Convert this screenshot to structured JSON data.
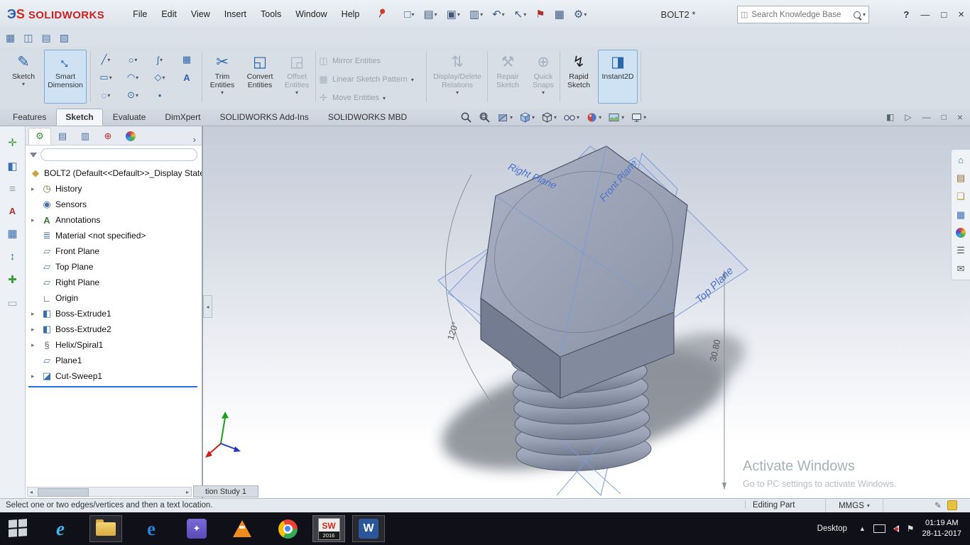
{
  "titlebar": {
    "logo_mark_d": "Э",
    "logo_mark_s": "S",
    "brand": "SOLIDWORKS",
    "menus": [
      "File",
      "Edit",
      "View",
      "Insert",
      "Tools",
      "Window",
      "Help"
    ],
    "document_title": "BOLT2 *",
    "search_placeholder": "Search Knowledge Base",
    "help": "?",
    "window": {
      "minimize": "—",
      "maximize": "□",
      "close": "×"
    }
  },
  "quickbar": {
    "glyphs": [
      "▦",
      "◫",
      "▤",
      "▧"
    ]
  },
  "toolbar": {
    "glyphs": [
      "□",
      "▤",
      "▣",
      "▥",
      "↶",
      "↖",
      "⚑",
      "▦",
      "⚙"
    ]
  },
  "ribbon": {
    "sketch": "Sketch",
    "smart_dimension": "Smart Dimension",
    "trim": "Trim Entities",
    "convert": "Convert Entities",
    "offset": "Offset Entities",
    "mirror": "Mirror Entities",
    "linear": "Linear Sketch Pattern",
    "move": "Move Entities",
    "display_delete": "Display/Delete Relations",
    "repair": "Repair Sketch",
    "quick_snaps": "Quick Snaps",
    "rapid": "Rapid Sketch",
    "instant2d": "Instant2D",
    "icons": {
      "sketch": "✎",
      "smart": "↔",
      "trim": "✂",
      "convert": "◱",
      "offset": "◲",
      "mirror": "◫",
      "linear": "▦",
      "move": "✛",
      "relations": "⇅",
      "repair": "⚒",
      "snaps": "⊕",
      "rapid": "↯",
      "instant": "◨"
    },
    "tools": [
      "╱",
      "○",
      "ʃ",
      "▦",
      "▭",
      "◠",
      "◇",
      "A",
      "◌",
      "⊙",
      "•"
    ]
  },
  "tabs": [
    "Features",
    "Sketch",
    "Evaluate",
    "DimXpert",
    "SOLIDWORKS Add-Ins",
    "SOLIDWORKS MBD"
  ],
  "doc_controls": [
    "◧",
    "▷",
    "—",
    "□",
    "×"
  ],
  "left_dock": [
    "✛",
    "◧",
    "≡",
    "A",
    "▦",
    "↕",
    "✚",
    "▭"
  ],
  "panel": {
    "tab_glyphs": [
      "⚙",
      "▤",
      "▥",
      "⊕"
    ],
    "root": "BOLT2 (Default<<Default>>_Display State",
    "items": [
      {
        "label": "History",
        "glyph": "◷"
      },
      {
        "label": "Sensors",
        "glyph": "◉"
      },
      {
        "label": "Annotations",
        "glyph": "A"
      },
      {
        "label": "Material <not specified>",
        "glyph": "≣"
      },
      {
        "label": "Front Plane",
        "glyph": "▱"
      },
      {
        "label": "Top Plane",
        "glyph": "▱"
      },
      {
        "label": "Right Plane",
        "glyph": "▱"
      },
      {
        "label": "Origin",
        "glyph": "∟"
      },
      {
        "label": "Boss-Extrude1",
        "glyph": "◧"
      },
      {
        "label": "Boss-Extrude2",
        "glyph": "◧"
      },
      {
        "label": "Helix/Spiral1",
        "glyph": "§"
      },
      {
        "label": "Plane1",
        "glyph": "▱"
      },
      {
        "label": "Cut-Sweep1",
        "glyph": "◪"
      }
    ]
  },
  "viewport": {
    "labels": {
      "right_plane": "Right Plane",
      "front_plane": "Front Plane",
      "top_plane": "Top Plane"
    },
    "dimensions": {
      "angle": "120°",
      "height": "30.80"
    },
    "watermark": {
      "title": "Activate Windows",
      "subtitle": "Go to PC settings to activate Windows."
    }
  },
  "motion_tab": "tion Study 1",
  "statusbar": {
    "message": "Select one or two edges/vertices and then a text location.",
    "mode": "Editing Part",
    "units": "MMGS"
  },
  "taskbar": {
    "desktop": "Desktop",
    "time": "01:19 AM",
    "date": "28-11-2017",
    "ie": "e",
    "edge": "e",
    "sw": "SW",
    "sw_year": "2016",
    "word": "W"
  },
  "icons_common": {
    "caret": "▾",
    "tree_arrow": "▸",
    "chevron_right": "›",
    "collapse": "◂",
    "scroll_left": "◂",
    "scroll_right": "▸",
    "pencil": "✎",
    "divider": "|",
    "tray_chevron": "▲"
  },
  "colors": {
    "accent": "#2a6de0",
    "plane_blue": "#7b9bd9",
    "highlight": "#cfe2f4"
  }
}
